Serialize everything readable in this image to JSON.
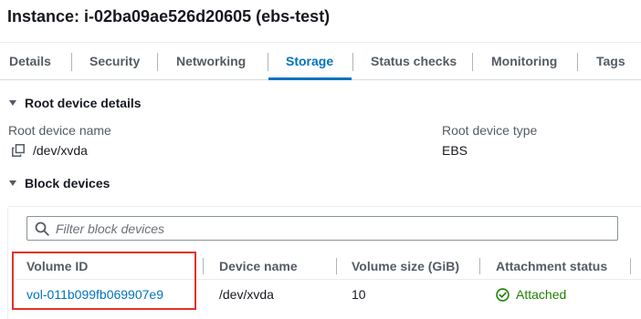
{
  "instance": {
    "title": "Instance: i-02ba09ae526d20605 (ebs-test)"
  },
  "tabs": [
    {
      "label": "Details"
    },
    {
      "label": "Security"
    },
    {
      "label": "Networking"
    },
    {
      "label": "Storage",
      "active": true
    },
    {
      "label": "Status checks"
    },
    {
      "label": "Monitoring"
    },
    {
      "label": "Tags"
    }
  ],
  "root_device": {
    "section_title": "Root device details",
    "name_label": "Root device name",
    "name_value": "/dev/xvda",
    "type_label": "Root device type",
    "type_value": "EBS"
  },
  "block_devices": {
    "section_title": "Block devices",
    "filter_placeholder": "Filter block devices",
    "columns": [
      "Volume ID",
      "Device name",
      "Volume size (GiB)",
      "Attachment status"
    ],
    "rows": [
      {
        "volume_id": "vol-011b099fb069907e9",
        "device_name": "/dev/xvda",
        "size": "10",
        "status": "Attached"
      }
    ]
  },
  "colors": {
    "accent": "#0073bb",
    "success": "#1d8102",
    "highlight": "#e0322a"
  },
  "icons": [
    "copy-icon",
    "search-icon",
    "check-circle-icon",
    "caret-down-icon"
  ]
}
